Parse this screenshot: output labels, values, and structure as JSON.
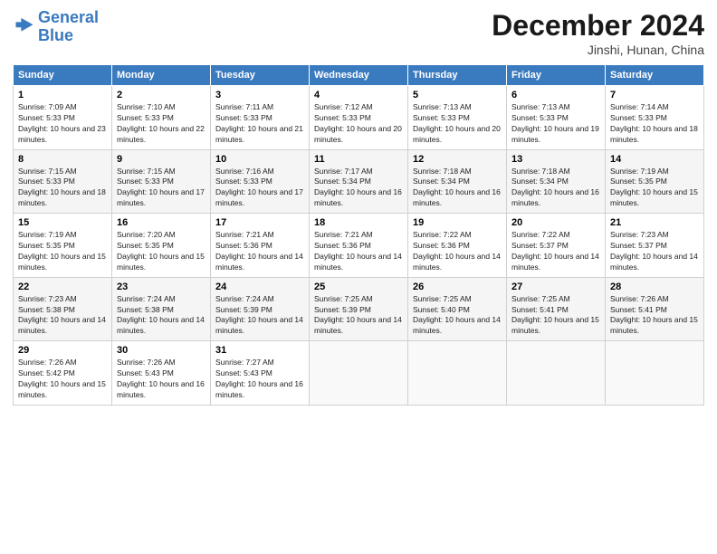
{
  "logo": {
    "line1": "General",
    "line2": "Blue"
  },
  "title": "December 2024",
  "subtitle": "Jinshi, Hunan, China",
  "weekdays": [
    "Sunday",
    "Monday",
    "Tuesday",
    "Wednesday",
    "Thursday",
    "Friday",
    "Saturday"
  ],
  "weeks": [
    [
      {
        "day": "1",
        "sunrise": "Sunrise: 7:09 AM",
        "sunset": "Sunset: 5:33 PM",
        "daylight": "Daylight: 10 hours and 23 minutes."
      },
      {
        "day": "2",
        "sunrise": "Sunrise: 7:10 AM",
        "sunset": "Sunset: 5:33 PM",
        "daylight": "Daylight: 10 hours and 22 minutes."
      },
      {
        "day": "3",
        "sunrise": "Sunrise: 7:11 AM",
        "sunset": "Sunset: 5:33 PM",
        "daylight": "Daylight: 10 hours and 21 minutes."
      },
      {
        "day": "4",
        "sunrise": "Sunrise: 7:12 AM",
        "sunset": "Sunset: 5:33 PM",
        "daylight": "Daylight: 10 hours and 20 minutes."
      },
      {
        "day": "5",
        "sunrise": "Sunrise: 7:13 AM",
        "sunset": "Sunset: 5:33 PM",
        "daylight": "Daylight: 10 hours and 20 minutes."
      },
      {
        "day": "6",
        "sunrise": "Sunrise: 7:13 AM",
        "sunset": "Sunset: 5:33 PM",
        "daylight": "Daylight: 10 hours and 19 minutes."
      },
      {
        "day": "7",
        "sunrise": "Sunrise: 7:14 AM",
        "sunset": "Sunset: 5:33 PM",
        "daylight": "Daylight: 10 hours and 18 minutes."
      }
    ],
    [
      {
        "day": "8",
        "sunrise": "Sunrise: 7:15 AM",
        "sunset": "Sunset: 5:33 PM",
        "daylight": "Daylight: 10 hours and 18 minutes."
      },
      {
        "day": "9",
        "sunrise": "Sunrise: 7:15 AM",
        "sunset": "Sunset: 5:33 PM",
        "daylight": "Daylight: 10 hours and 17 minutes."
      },
      {
        "day": "10",
        "sunrise": "Sunrise: 7:16 AM",
        "sunset": "Sunset: 5:33 PM",
        "daylight": "Daylight: 10 hours and 17 minutes."
      },
      {
        "day": "11",
        "sunrise": "Sunrise: 7:17 AM",
        "sunset": "Sunset: 5:34 PM",
        "daylight": "Daylight: 10 hours and 16 minutes."
      },
      {
        "day": "12",
        "sunrise": "Sunrise: 7:18 AM",
        "sunset": "Sunset: 5:34 PM",
        "daylight": "Daylight: 10 hours and 16 minutes."
      },
      {
        "day": "13",
        "sunrise": "Sunrise: 7:18 AM",
        "sunset": "Sunset: 5:34 PM",
        "daylight": "Daylight: 10 hours and 16 minutes."
      },
      {
        "day": "14",
        "sunrise": "Sunrise: 7:19 AM",
        "sunset": "Sunset: 5:35 PM",
        "daylight": "Daylight: 10 hours and 15 minutes."
      }
    ],
    [
      {
        "day": "15",
        "sunrise": "Sunrise: 7:19 AM",
        "sunset": "Sunset: 5:35 PM",
        "daylight": "Daylight: 10 hours and 15 minutes."
      },
      {
        "day": "16",
        "sunrise": "Sunrise: 7:20 AM",
        "sunset": "Sunset: 5:35 PM",
        "daylight": "Daylight: 10 hours and 15 minutes."
      },
      {
        "day": "17",
        "sunrise": "Sunrise: 7:21 AM",
        "sunset": "Sunset: 5:36 PM",
        "daylight": "Daylight: 10 hours and 14 minutes."
      },
      {
        "day": "18",
        "sunrise": "Sunrise: 7:21 AM",
        "sunset": "Sunset: 5:36 PM",
        "daylight": "Daylight: 10 hours and 14 minutes."
      },
      {
        "day": "19",
        "sunrise": "Sunrise: 7:22 AM",
        "sunset": "Sunset: 5:36 PM",
        "daylight": "Daylight: 10 hours and 14 minutes."
      },
      {
        "day": "20",
        "sunrise": "Sunrise: 7:22 AM",
        "sunset": "Sunset: 5:37 PM",
        "daylight": "Daylight: 10 hours and 14 minutes."
      },
      {
        "day": "21",
        "sunrise": "Sunrise: 7:23 AM",
        "sunset": "Sunset: 5:37 PM",
        "daylight": "Daylight: 10 hours and 14 minutes."
      }
    ],
    [
      {
        "day": "22",
        "sunrise": "Sunrise: 7:23 AM",
        "sunset": "Sunset: 5:38 PM",
        "daylight": "Daylight: 10 hours and 14 minutes."
      },
      {
        "day": "23",
        "sunrise": "Sunrise: 7:24 AM",
        "sunset": "Sunset: 5:38 PM",
        "daylight": "Daylight: 10 hours and 14 minutes."
      },
      {
        "day": "24",
        "sunrise": "Sunrise: 7:24 AM",
        "sunset": "Sunset: 5:39 PM",
        "daylight": "Daylight: 10 hours and 14 minutes."
      },
      {
        "day": "25",
        "sunrise": "Sunrise: 7:25 AM",
        "sunset": "Sunset: 5:39 PM",
        "daylight": "Daylight: 10 hours and 14 minutes."
      },
      {
        "day": "26",
        "sunrise": "Sunrise: 7:25 AM",
        "sunset": "Sunset: 5:40 PM",
        "daylight": "Daylight: 10 hours and 14 minutes."
      },
      {
        "day": "27",
        "sunrise": "Sunrise: 7:25 AM",
        "sunset": "Sunset: 5:41 PM",
        "daylight": "Daylight: 10 hours and 15 minutes."
      },
      {
        "day": "28",
        "sunrise": "Sunrise: 7:26 AM",
        "sunset": "Sunset: 5:41 PM",
        "daylight": "Daylight: 10 hours and 15 minutes."
      }
    ],
    [
      {
        "day": "29",
        "sunrise": "Sunrise: 7:26 AM",
        "sunset": "Sunset: 5:42 PM",
        "daylight": "Daylight: 10 hours and 15 minutes."
      },
      {
        "day": "30",
        "sunrise": "Sunrise: 7:26 AM",
        "sunset": "Sunset: 5:43 PM",
        "daylight": "Daylight: 10 hours and 16 minutes."
      },
      {
        "day": "31",
        "sunrise": "Sunrise: 7:27 AM",
        "sunset": "Sunset: 5:43 PM",
        "daylight": "Daylight: 10 hours and 16 minutes."
      },
      null,
      null,
      null,
      null
    ]
  ]
}
